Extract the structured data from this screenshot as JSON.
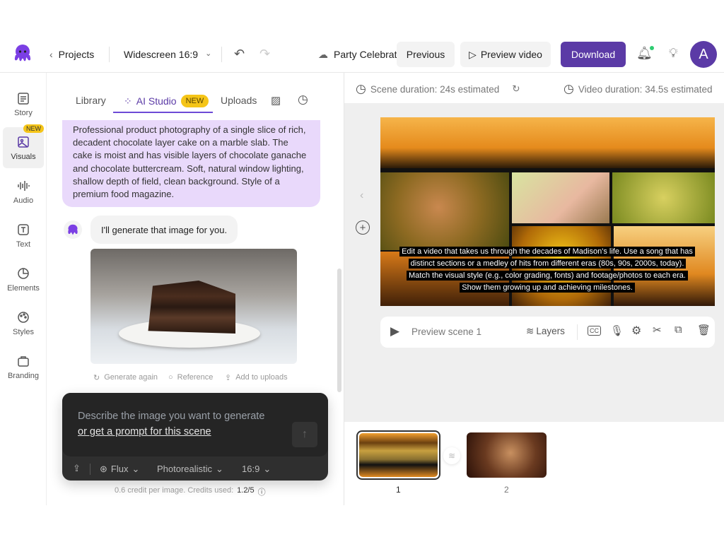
{
  "header": {
    "back_label": "Projects",
    "format": "Widescreen 16:9",
    "project_name": "Party Celebrat",
    "previous": "Previous",
    "preview_video": "Preview video",
    "download": "Download",
    "avatar_letter": "A"
  },
  "sidebar": {
    "items": [
      {
        "label": "Story"
      },
      {
        "label": "Visuals",
        "badge": "NEW"
      },
      {
        "label": "Audio"
      },
      {
        "label": "Text"
      },
      {
        "label": "Elements"
      },
      {
        "label": "Styles"
      },
      {
        "label": "Branding"
      }
    ]
  },
  "panel": {
    "tabs": {
      "library": "Library",
      "ai_studio": "AI Studio",
      "ai_badge": "NEW",
      "uploads": "Uploads"
    },
    "user_prompt": "Professional product photography of a single slice of rich, decadent chocolate layer cake on a marble slab. The cake is moist and has visible layers of chocolate ganache and chocolate buttercream. Soft, natural window lighting, shallow depth of field, clean background. Style of a premium food magazine.",
    "bot_reply": "I'll generate that image for you.",
    "actions": {
      "generate_again": "Generate again",
      "reference": "Reference",
      "add_to_uploads": "Add to uploads"
    },
    "composer": {
      "placeholder": "Describe the image you want to generate",
      "prompt_link": "or get a prompt for this scene",
      "model": "Flux",
      "style": "Photorealistic",
      "ratio": "16:9"
    },
    "credits_text": "0.6 credit per image. Credits used:",
    "credits_value": "1.2/5"
  },
  "canvas": {
    "scene_duration": "Scene duration: 24s estimated",
    "video_duration": "Video duration: 34.5s estimated",
    "caption": "Edit a video that takes us through the decades of Madison's life. Use a song that has distinct sections or a medley of hits from different eras (80s, 90s, 2000s, today). Match the visual style (e.g., color grading, fonts) and footage/photos to each era. Show them growing up and achieving milestones.",
    "preview_scene": "Preview scene 1",
    "layers": "Layers"
  },
  "scenes": [
    {
      "number": "1"
    },
    {
      "number": "2"
    }
  ],
  "colors": {
    "accent": "#5b3aa6",
    "badge": "#f5c518",
    "prompt_bg": "#e9d9fb"
  }
}
